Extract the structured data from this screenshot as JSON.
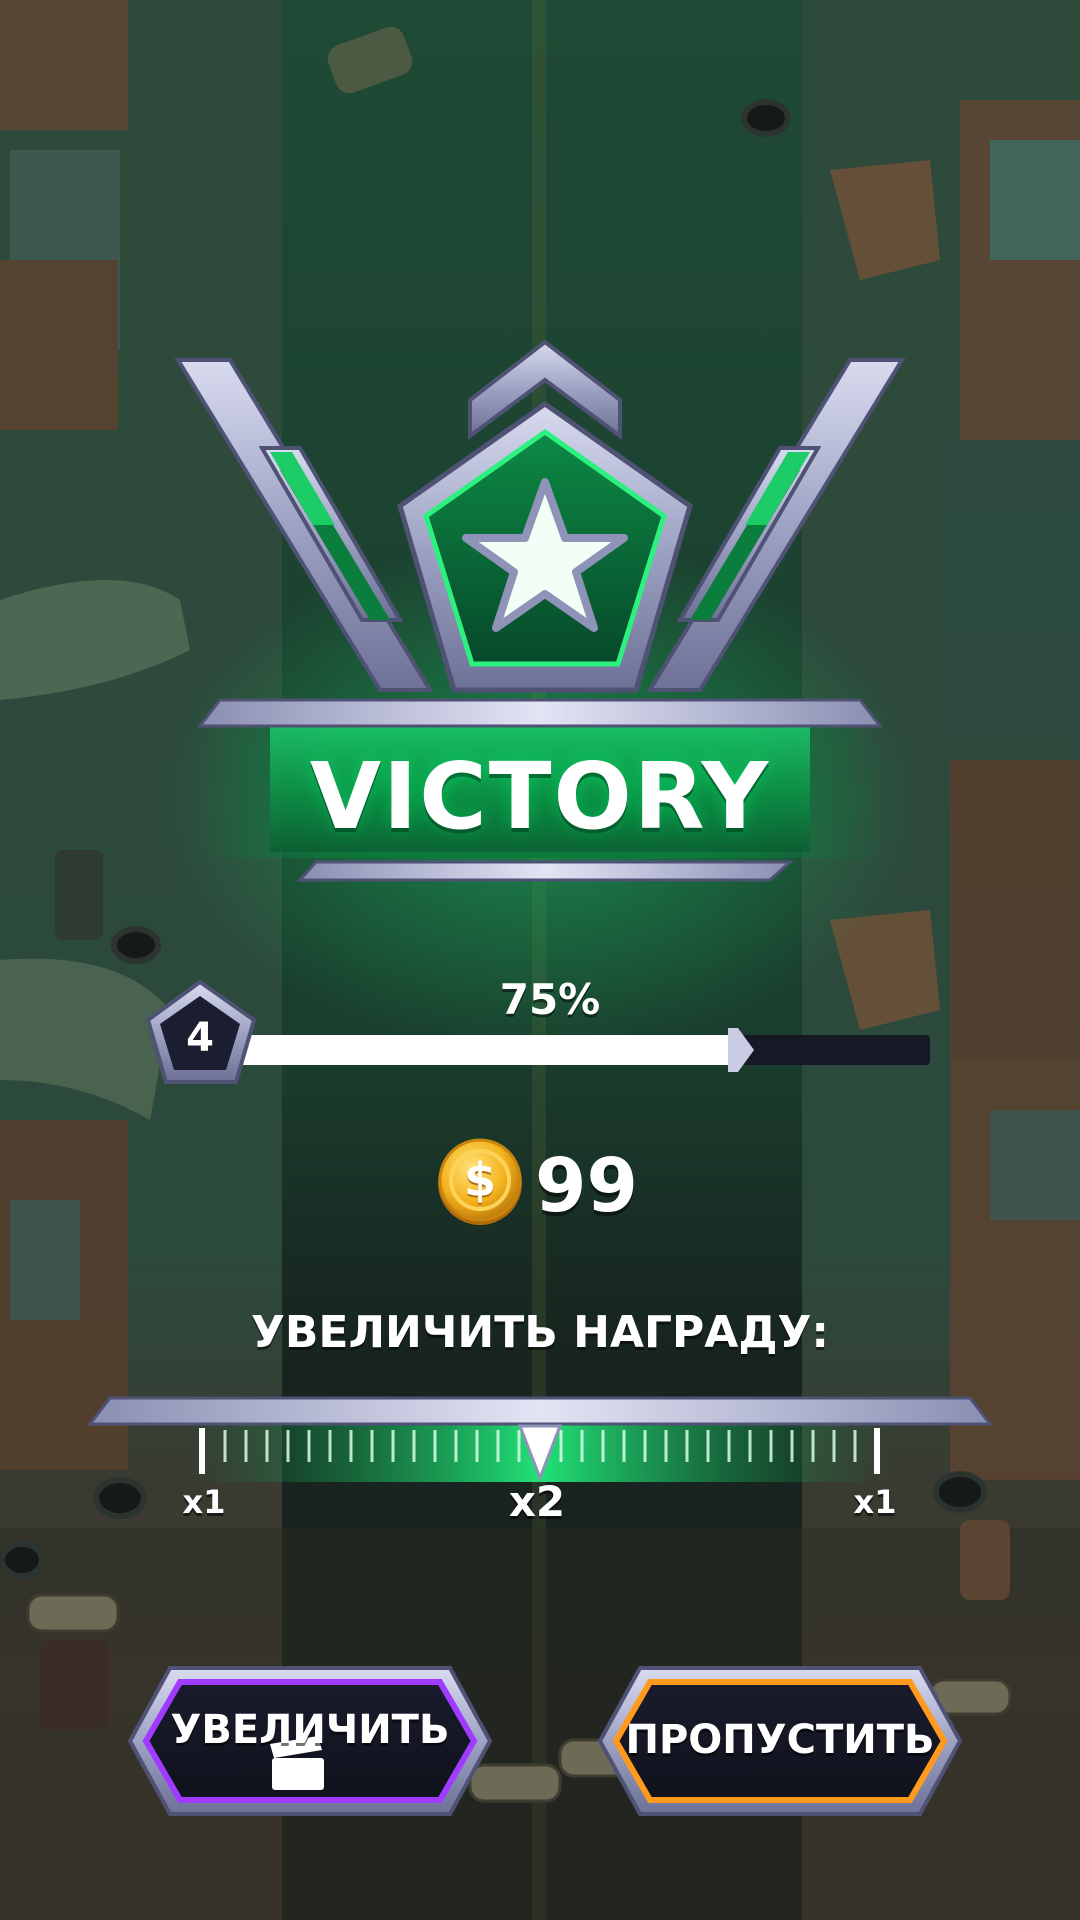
{
  "colors": {
    "accent_green": "#16d66a",
    "progress_fill": "#ffffff",
    "progress_track": "#151825",
    "boost_button_border": "#a13bff",
    "skip_button_border": "#ff9a1c",
    "metal": "#9ea3c4"
  },
  "result": {
    "title": "VICTORY",
    "emblem_icon": "star-icon"
  },
  "level": {
    "value": "4",
    "progress_label": "75%",
    "progress": 0.75
  },
  "reward": {
    "coin_icon": "coin-icon",
    "amount": "99"
  },
  "boost": {
    "title": "УВЕЛИЧИТЬ НАГРАДУ:",
    "multipliers": [
      {
        "label": "x1"
      },
      {
        "label": "x2"
      },
      {
        "label": "x1"
      }
    ],
    "pointer_value": "x2"
  },
  "buttons": {
    "boost": {
      "label": "УВЕЛИЧИТЬ",
      "icon": "clapperboard-icon"
    },
    "skip": {
      "label": "ПРОПУСТИТЬ"
    }
  }
}
